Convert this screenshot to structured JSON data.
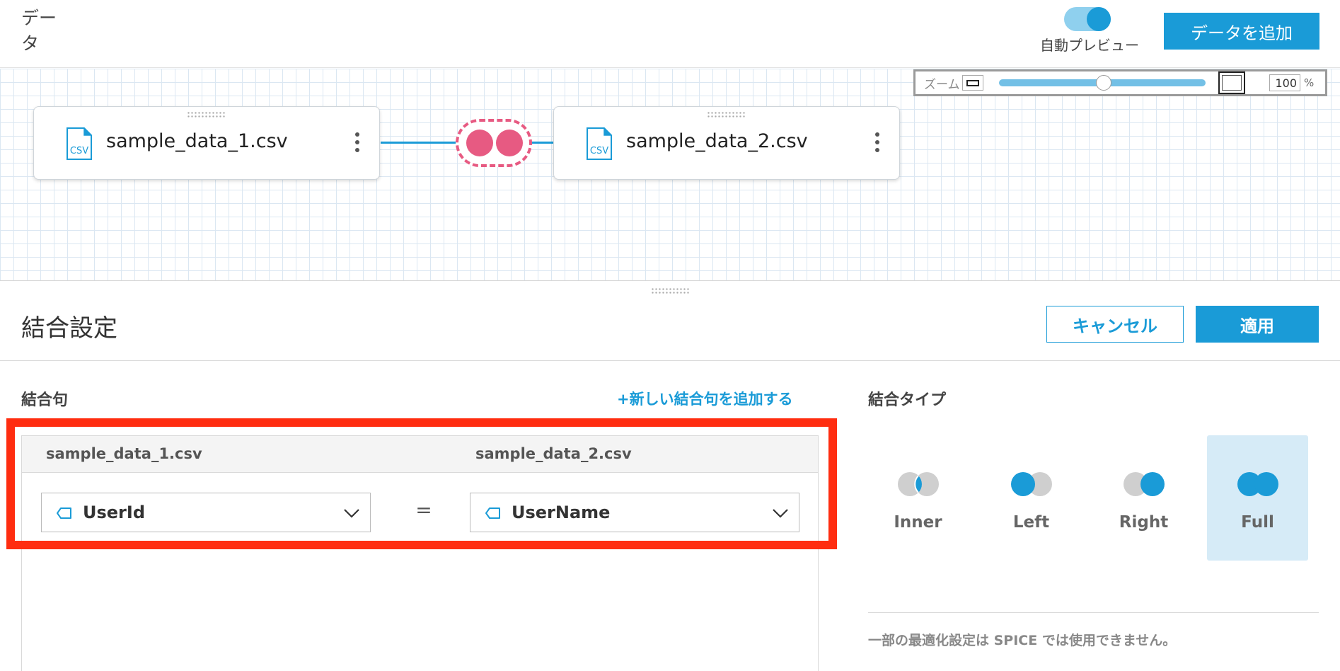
{
  "header": {
    "title": "データ",
    "auto_preview_label": "自動プレビュー",
    "auto_preview_on": true,
    "add_data_label": "データを追加"
  },
  "zoom": {
    "label": "ズーム",
    "value": "100",
    "unit": "%",
    "level": 0.5
  },
  "canvas": {
    "nodes": [
      {
        "name": "sample_data_1.csv",
        "icon": "csv-file-icon",
        "icon_text": "CSV"
      },
      {
        "name": "sample_data_2.csv",
        "icon": "csv-file-icon",
        "icon_text": "CSV"
      }
    ],
    "join_icon": "full-join-icon",
    "join_color": "#e75a82"
  },
  "join_config": {
    "title": "結合設定",
    "cancel_label": "キャンセル",
    "apply_label": "適用",
    "clause_title": "結合句",
    "add_clause_label": "+新しい結合句を追加する",
    "left_source": "sample_data_1.csv",
    "right_source": "sample_data_2.csv",
    "clauses": [
      {
        "left_field": "UserId",
        "operator": "=",
        "right_field": "UserName"
      }
    ],
    "type_title": "結合タイプ",
    "types": [
      {
        "label": "Inner",
        "selected": false
      },
      {
        "label": "Left",
        "selected": false
      },
      {
        "label": "Right",
        "selected": false
      },
      {
        "label": "Full",
        "selected": true
      }
    ],
    "note": "一部の最適化設定は SPICE では使用できません。"
  },
  "colors": {
    "accent": "#1a9bd7",
    "highlight": "#ff2d10",
    "selected_bg": "#d6ebf7"
  }
}
